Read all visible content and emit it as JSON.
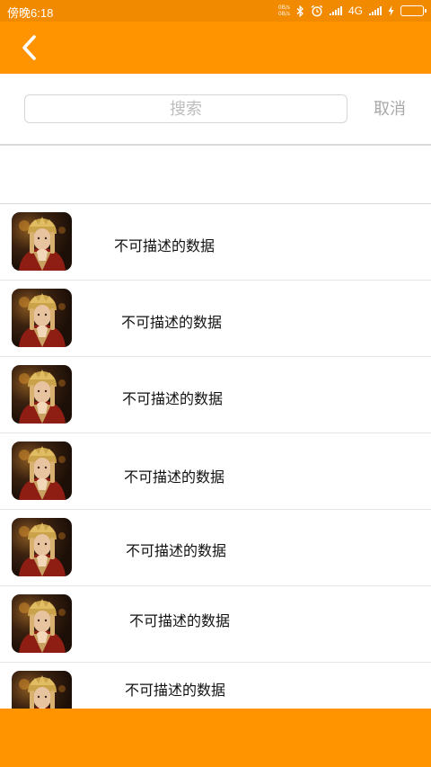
{
  "status_bar": {
    "time": "傍晚6:18",
    "speed_top": "0B/s",
    "speed_bottom": "0B/s",
    "network": "4G",
    "icons": [
      "bluetooth-icon",
      "alarm-icon",
      "signal-icon",
      "charging-icon",
      "battery-icon"
    ]
  },
  "app_bar": {
    "back_icon": "chevron-left-icon",
    "color": "#FF9400"
  },
  "search": {
    "placeholder": "搜索",
    "value": "",
    "cancel_label": "取消"
  },
  "list": {
    "items": [
      {
        "avatar": "character-portrait",
        "text": "不可描述的数据"
      },
      {
        "avatar": "character-portrait",
        "text": "不可描述的数据"
      },
      {
        "avatar": "character-portrait",
        "text": "不可描述的数据"
      },
      {
        "avatar": "character-portrait",
        "text": "不可描述的数据"
      },
      {
        "avatar": "character-portrait",
        "text": "不可描述的数据"
      },
      {
        "avatar": "character-portrait",
        "text": "不可描述的数据"
      },
      {
        "avatar": "character-portrait",
        "text": "不可描述的数据"
      }
    ]
  },
  "colors": {
    "accent": "#FF9400",
    "status_bar": "#F28A00",
    "battery": "#46D23C",
    "placeholder": "#BDBDBD",
    "cancel": "#A8A8A8"
  }
}
